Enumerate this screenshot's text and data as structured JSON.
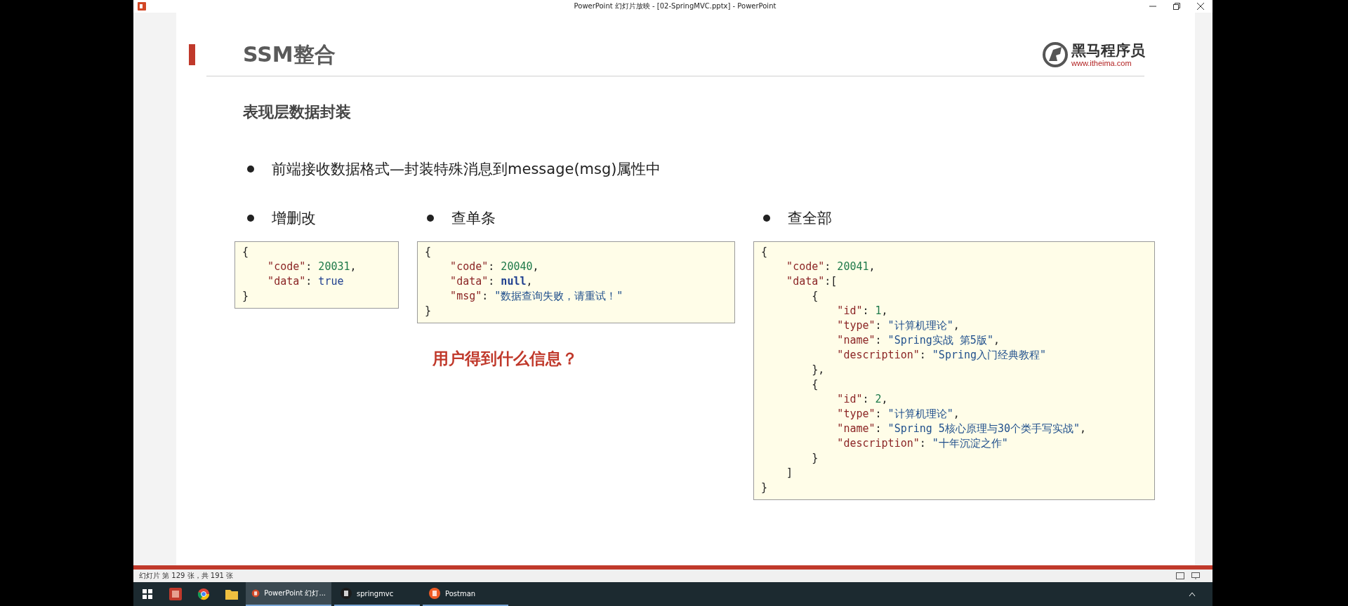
{
  "window": {
    "title": "PowerPoint 幻灯片放映 - [02-SpringMVC.pptx] - PowerPoint"
  },
  "slide": {
    "title": "SSM整合",
    "logo": {
      "name": "黑马程序员",
      "url": "www.itheima.com"
    },
    "subtitle": "表现层数据封装",
    "bullet": "前端接收数据格式—封装特殊消息到message(msg)属性中",
    "columns": [
      {
        "heading": "增删改",
        "lines": [
          {
            "tokens": [
              {
                "kind": "punct",
                "text": "{"
              }
            ],
            "children": [
              {
                "tokens": [
                  {
                    "kind": "key",
                    "text": "\"code\""
                  },
                  {
                    "kind": "punct",
                    "text": ":"
                  },
                  {
                    "kind": "number",
                    "text": "20031"
                  },
                  {
                    "kind": "punct",
                    "text": ","
                  }
                ]
              },
              {
                "tokens": [
                  {
                    "kind": "key",
                    "text": "\"data\""
                  },
                  {
                    "kind": "punct",
                    "text": ":"
                  },
                  {
                    "kind": "literal",
                    "text": "true"
                  }
                ]
              }
            ]
          },
          {
            "tokens": [
              {
                "kind": "punct",
                "text": "}"
              }
            ]
          }
        ]
      },
      {
        "heading": "查单条",
        "lines": [
          {
            "tokens": [
              {
                "kind": "punct",
                "text": "{"
              }
            ],
            "children": [
              {
                "tokens": [
                  {
                    "kind": "key",
                    "text": "\"code\""
                  },
                  {
                    "kind": "punct",
                    "text": ":"
                  },
                  {
                    "kind": "number",
                    "text": "20040"
                  },
                  {
                    "kind": "punct",
                    "text": ","
                  }
                ]
              },
              {
                "tokens": [
                  {
                    "kind": "key",
                    "text": "\"data\""
                  },
                  {
                    "kind": "punct",
                    "text": ":"
                  },
                  {
                    "kind": "null",
                    "text": "null"
                  },
                  {
                    "kind": "punct",
                    "text": ","
                  }
                ]
              },
              {
                "tokens": [
                  {
                    "kind": "key",
                    "text": "\"msg\""
                  },
                  {
                    "kind": "punct",
                    "text": ":"
                  },
                  {
                    "kind": "string",
                    "text": "\"数据查询失败，请重试！\""
                  }
                ]
              }
            ]
          },
          {
            "tokens": [
              {
                "kind": "punct",
                "text": "}"
              }
            ]
          }
        ]
      },
      {
        "heading": "查全部",
        "lines": [
          {
            "tokens": [
              {
                "kind": "punct",
                "text": "{"
              }
            ],
            "children": [
              {
                "tokens": [
                  {
                    "kind": "key",
                    "text": "\"code\""
                  },
                  {
                    "kind": "punct",
                    "text": ":"
                  },
                  {
                    "kind": "number",
                    "text": "20041"
                  },
                  {
                    "kind": "punct",
                    "text": ","
                  }
                ]
              },
              {
                "tokens": [
                  {
                    "kind": "key",
                    "text": "\"data\""
                  },
                  {
                    "kind": "punct",
                    "text": ":["
                  }
                ],
                "children": [
                  {
                    "tokens": [
                      {
                        "kind": "punct",
                        "text": "{"
                      }
                    ],
                    "children": [
                      {
                        "tokens": [
                          {
                            "kind": "key",
                            "text": "\"id\""
                          },
                          {
                            "kind": "punct",
                            "text": ":"
                          },
                          {
                            "kind": "number",
                            "text": "1"
                          },
                          {
                            "kind": "punct",
                            "text": ","
                          }
                        ]
                      },
                      {
                        "tokens": [
                          {
                            "kind": "key",
                            "text": "\"type\""
                          },
                          {
                            "kind": "punct",
                            "text": ":"
                          },
                          {
                            "kind": "string",
                            "text": "\"计算机理论\""
                          },
                          {
                            "kind": "punct",
                            "text": ","
                          }
                        ]
                      },
                      {
                        "tokens": [
                          {
                            "kind": "key",
                            "text": "\"name\""
                          },
                          {
                            "kind": "punct",
                            "text": ":"
                          },
                          {
                            "kind": "string",
                            "text": "\"Spring实战 第5版\""
                          },
                          {
                            "kind": "punct",
                            "text": ","
                          }
                        ]
                      },
                      {
                        "tokens": [
                          {
                            "kind": "key",
                            "text": "\"description\""
                          },
                          {
                            "kind": "punct",
                            "text": ":"
                          },
                          {
                            "kind": "string",
                            "text": "\"Spring入门经典教程\""
                          }
                        ]
                      }
                    ]
                  },
                  {
                    "tokens": [
                      {
                        "kind": "punct",
                        "text": "},"
                      }
                    ]
                  },
                  {
                    "tokens": [
                      {
                        "kind": "punct",
                        "text": "{"
                      }
                    ],
                    "children": [
                      {
                        "tokens": [
                          {
                            "kind": "key",
                            "text": "\"id\""
                          },
                          {
                            "kind": "punct",
                            "text": ":"
                          },
                          {
                            "kind": "number",
                            "text": "2"
                          },
                          {
                            "kind": "punct",
                            "text": ","
                          }
                        ]
                      },
                      {
                        "tokens": [
                          {
                            "kind": "key",
                            "text": "\"type\""
                          },
                          {
                            "kind": "punct",
                            "text": ":"
                          },
                          {
                            "kind": "string",
                            "text": "\"计算机理论\""
                          },
                          {
                            "kind": "punct",
                            "text": ","
                          }
                        ]
                      },
                      {
                        "tokens": [
                          {
                            "kind": "key",
                            "text": "\"name\""
                          },
                          {
                            "kind": "punct",
                            "text": ":"
                          },
                          {
                            "kind": "string",
                            "text": "\"Spring 5核心原理与30个类手写实战\""
                          },
                          {
                            "kind": "punct",
                            "text": ","
                          }
                        ]
                      },
                      {
                        "tokens": [
                          {
                            "kind": "key",
                            "text": "\"description\""
                          },
                          {
                            "kind": "punct",
                            "text": ":"
                          },
                          {
                            "kind": "string",
                            "text": "\"十年沉淀之作\""
                          }
                        ]
                      }
                    ]
                  },
                  {
                    "tokens": [
                      {
                        "kind": "punct",
                        "text": "}"
                      }
                    ]
                  }
                ]
              },
              {
                "tokens": [
                  {
                    "kind": "punct",
                    "text": "]"
                  }
                ]
              }
            ]
          },
          {
            "tokens": [
              {
                "kind": "punct",
                "text": "}"
              }
            ]
          }
        ]
      }
    ],
    "question": "用户得到什么信息？"
  },
  "status_bar": {
    "text": "幻灯片 第 129 张，共 191 张"
  },
  "taskbar": {
    "items": [
      {
        "label": "PowerPoint 幻灯...",
        "selected": true
      },
      {
        "label": "springmvc",
        "selected": false
      },
      {
        "label": "Postman",
        "selected": false
      }
    ]
  }
}
